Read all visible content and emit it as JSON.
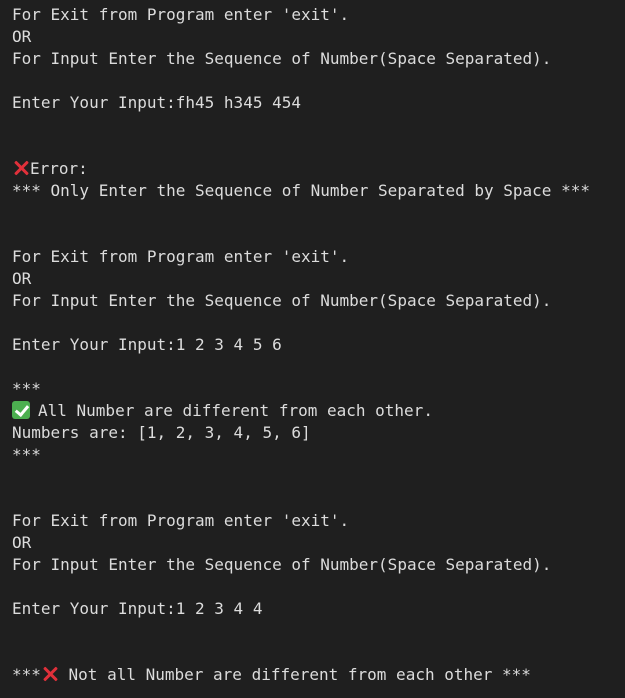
{
  "terminal": {
    "background_color": "#1f1f1f",
    "text_color": "#dcdcdc",
    "error_icon_color": "#e0303a",
    "success_icon_color": "#4caf50",
    "block1": {
      "exit_prompt": "For Exit from Program enter 'exit'.",
      "or_text": "OR",
      "input_prompt": "For Input Enter the Sequence of Number(Space Separated).",
      "input_line": "Enter Your Input:fh45 h345 454",
      "error_title": "Error:",
      "error_message": "*** Only Enter the Sequence of Number Separated by Space ***"
    },
    "block2": {
      "exit_prompt": "For Exit from Program enter 'exit'.",
      "or_text": "OR",
      "input_prompt": "For Input Enter the Sequence of Number(Space Separated).",
      "input_line": "Enter Your Input:1 2 3 4 5 6",
      "stars_top": "***",
      "success_message": "All Number are different from each other.",
      "numbers_line": "Numbers are: [1, 2, 3, 4, 5, 6]",
      "stars_bottom": "***"
    },
    "block3": {
      "exit_prompt": "For Exit from Program enter 'exit'.",
      "or_text": "OR",
      "input_prompt": "For Input Enter the Sequence of Number(Space Separated).",
      "input_line": "Enter Your Input:1 2 3 4 4",
      "result_prefix": "***",
      "result_message": " Not all Number are different from each other ***"
    }
  }
}
